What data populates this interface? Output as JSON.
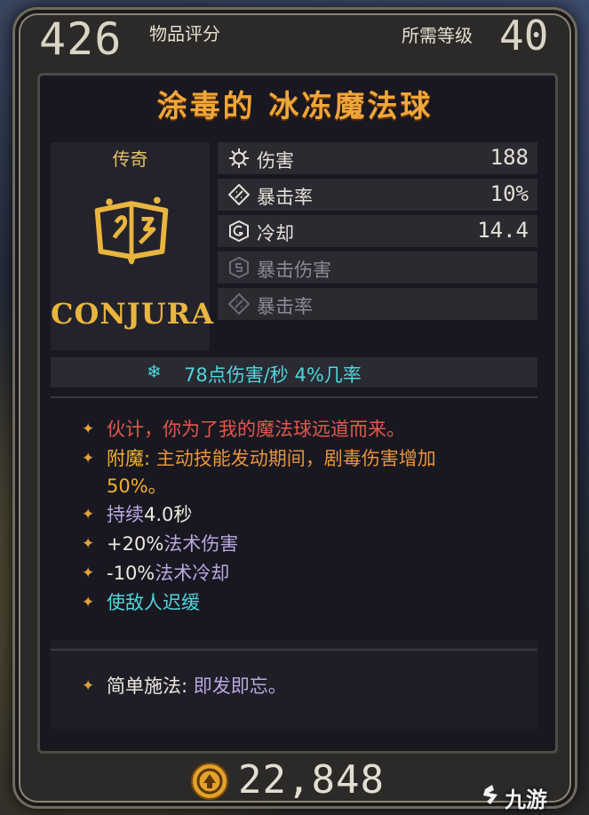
{
  "header": {
    "item_score": "426",
    "item_score_label": "物品评分",
    "required_level_label": "所需等级",
    "required_level": "40"
  },
  "item": {
    "name": "涂毒的 冰冻魔法球",
    "rarity": "传奇",
    "brand": "CONJURA",
    "icon": "spellbook-icon",
    "name_color": "#f0a63a"
  },
  "stats": [
    {
      "name": "伤害",
      "value": "188",
      "icon": "damage-icon",
      "active": true
    },
    {
      "name": "暴击率",
      "value": "10%",
      "icon": "crit-rate-icon",
      "active": true
    },
    {
      "name": "冷却",
      "value": "14.4",
      "icon": "cooldown-icon",
      "active": true
    },
    {
      "name": "暴击伤害",
      "value": "",
      "icon": "crit-damage-icon",
      "active": false
    },
    {
      "name": "暴击率",
      "value": "",
      "icon": "crit-rate-icon",
      "active": false
    }
  ],
  "elemental": {
    "icon": "cryo-icon",
    "text": "78点伤害/秒  4%几率",
    "color": "#4fd6dc"
  },
  "flavor_text": "伙计，你为了我的魔法球远道而来。",
  "anoint": {
    "label": "附魔:",
    "text": "主动技能发动期间，剧毒伤害增加",
    "text_cont": "50%。"
  },
  "effects": [
    {
      "prefix": "持续",
      "value": "4.0秒"
    },
    {
      "prefix": "+20%",
      "value": "法术伤害"
    },
    {
      "prefix": "-10%",
      "value": "法术冷却"
    }
  ],
  "slow_effect": "使敌人迟缓",
  "cast": {
    "label": "简单施法:",
    "value": "即发即忘。"
  },
  "price": "22,848",
  "watermark": "九游"
}
